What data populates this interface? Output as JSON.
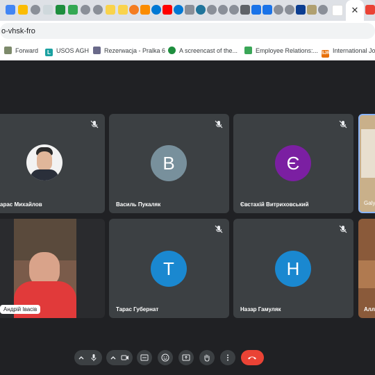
{
  "browser": {
    "tab_close_glyph": "✕",
    "url": "o-vhsk-fro",
    "bookmarks": [
      {
        "label": "Forward",
        "icon": "folder-icon",
        "color": "#5f6368"
      },
      {
        "label": "USOS AGH",
        "icon": "usos-icon",
        "color": "#1aa1a1"
      },
      {
        "label": "Rezerwacja - Pralka 6",
        "icon": "laundry-icon",
        "color": "#6a6a8a"
      },
      {
        "label": "A screencast of the...",
        "icon": "screencast-icon",
        "color": "#1e8e3e"
      },
      {
        "label": "Employee Relations:...",
        "icon": "employee-icon",
        "color": "#3aa657"
      },
      {
        "label": "International Jou",
        "icon": "sjr-icon",
        "color": "#e8710a"
      }
    ]
  },
  "meeting": {
    "participants": [
      {
        "name": "арас Михайлов",
        "avatar_type": "photo",
        "initial": "",
        "color": "#ffffff"
      },
      {
        "name": "Василь Пукаляк",
        "avatar_type": "letter",
        "initial": "В",
        "color": "#78909c"
      },
      {
        "name": "Євстахій Витриховський",
        "avatar_type": "letter",
        "initial": "Є",
        "color": "#7b1fa2"
      },
      {
        "name": "Galy",
        "avatar_type": "video",
        "initial": "",
        "color": "#c9b08a"
      },
      {
        "name": "Андрій Івасів",
        "avatar_type": "video",
        "initial": "",
        "color": "#d32f2f"
      },
      {
        "name": "Тарас Губернат",
        "avatar_type": "letter",
        "initial": "Т",
        "color": "#1a88d0"
      },
      {
        "name": "Назар Гамуляк",
        "avatar_type": "letter",
        "initial": "Н",
        "color": "#1a88d0"
      },
      {
        "name": "Алл",
        "avatar_type": "video",
        "initial": "",
        "color": "#8a5a3a"
      }
    ],
    "colors": {
      "background": "#202124",
      "tile": "#3c4043",
      "end_call": "#ea4335"
    }
  }
}
